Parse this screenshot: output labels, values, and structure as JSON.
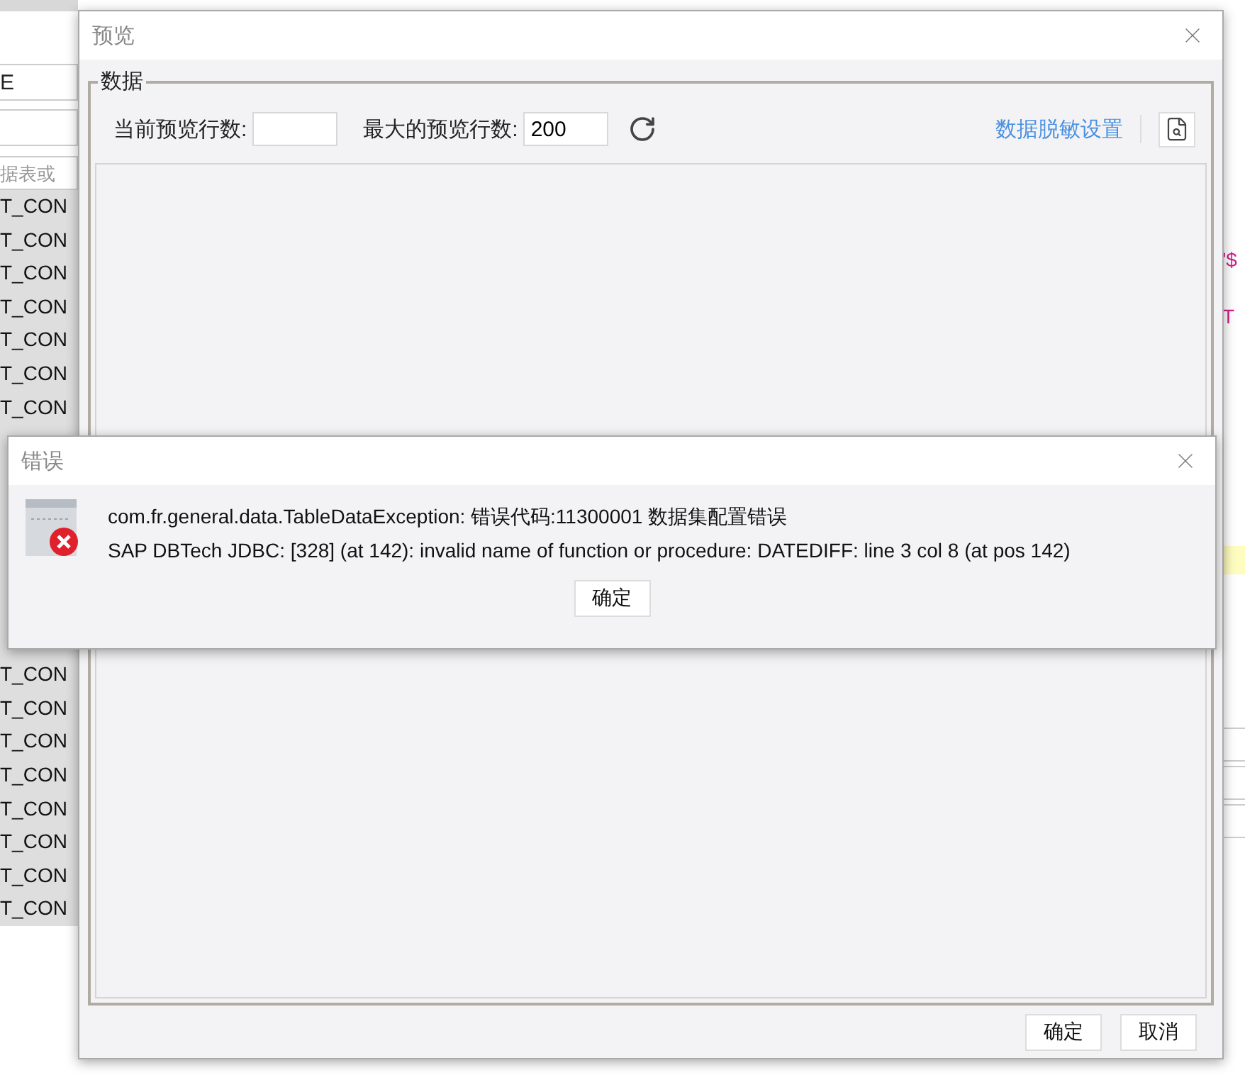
{
  "background_app": {
    "name_field": "E",
    "search": {
      "placeholder": "据表或"
    },
    "list_upper": [
      {
        "text": "T_CON"
      },
      {
        "text": "T_CON"
      },
      {
        "text": "T_CON"
      },
      {
        "text": "T_CON"
      },
      {
        "text": "T_CON"
      },
      {
        "text": "T_CON"
      },
      {
        "text": "T_CON"
      }
    ],
    "list_lower": [
      {
        "text": "T_CON"
      },
      {
        "text": "T_CON"
      },
      {
        "text": "T_CON"
      },
      {
        "text": "T_CON"
      },
      {
        "text": "T_CON"
      },
      {
        "text": "T_CON"
      },
      {
        "text": "T_CON"
      },
      {
        "text": "T_CON"
      }
    ],
    "editor_fragments": [
      "'$",
      "T"
    ]
  },
  "preview_dialog": {
    "title": "预览",
    "group_title": "数据",
    "current_rows_label": "当前预览行数:",
    "max_rows_label": "最大的预览行数:",
    "max_rows_value": "200",
    "masking_link": "数据脱敏设置",
    "buttons": [
      "确定",
      "取消"
    ]
  },
  "error_dialog": {
    "title": "错误",
    "lines": [
      "com.fr.general.data.TableDataException: 错误代码:11300001 数据集配置错误",
      "SAP DBTech JDBC: [328] (at 142): invalid name of function or procedure: DATEDIFF: line 3 col 8 (at pos 142)"
    ],
    "button": "确定"
  }
}
